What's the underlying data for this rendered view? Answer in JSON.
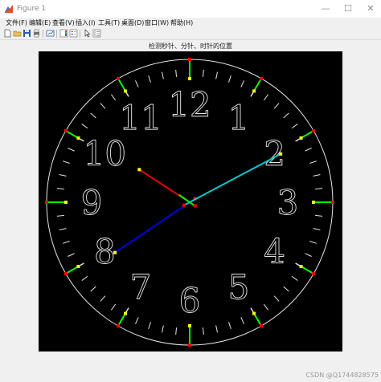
{
  "window": {
    "title": "Figure 1",
    "minimize_glyph": "—",
    "maximize_glyph": "☐",
    "close_glyph": "✕"
  },
  "menu": {
    "items": [
      {
        "label": "文件(F)"
      },
      {
        "label": "编辑(E)"
      },
      {
        "label": "查看(V)"
      },
      {
        "label": "插入(I)"
      },
      {
        "label": "工具(T)"
      },
      {
        "label": "桌面(D)"
      },
      {
        "label": "窗口(W)"
      },
      {
        "label": "帮助(H)"
      }
    ]
  },
  "toolbar": {
    "buttons": [
      {
        "icon": "new-figure-icon"
      },
      {
        "icon": "open-file-icon"
      },
      {
        "icon": "save-icon"
      },
      {
        "icon": "print-icon"
      },
      {
        "icon": "link-plot-icon"
      },
      {
        "icon": "insert-colorbar-icon"
      },
      {
        "icon": "insert-legend-icon"
      },
      {
        "icon": "edit-plot-arrow-icon"
      },
      {
        "icon": "property-inspector-icon"
      }
    ]
  },
  "figure": {
    "title": "检测秒针、分针、时针的位置",
    "numerals": [
      "12",
      "1",
      "2",
      "3",
      "4",
      "5",
      "6",
      "7",
      "8",
      "9",
      "10",
      "11"
    ],
    "hands": [
      {
        "name": "hour",
        "color": "#0000dd",
        "angle_deg": 236,
        "length": 0.63
      },
      {
        "name": "minute",
        "color": "#00cccc",
        "angle_deg": 62,
        "length": 0.72
      },
      {
        "name": "second",
        "color": "#ee0000",
        "angle_deg": 303,
        "length": 0.42
      }
    ],
    "colors": {
      "background": "#000000",
      "dial": "#e6e6e6",
      "marker_green": "#00ff00",
      "marker_yellow": "#ffff00",
      "marker_red": "#ff0000"
    }
  },
  "watermark": "CSDN @Q1744828575"
}
